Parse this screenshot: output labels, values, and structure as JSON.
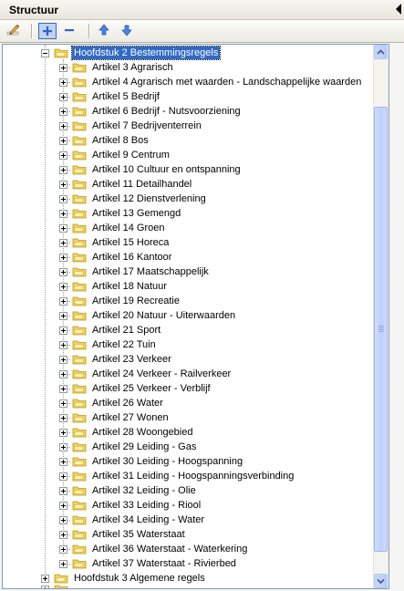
{
  "panel": {
    "title": "Structuur"
  },
  "toolbar": {
    "edit_icon": "pencil-icon",
    "expand_icon": "plus-icon",
    "collapse_icon": "minus-icon",
    "move_up_icon": "arrow-up-icon",
    "move_down_icon": "arrow-down-icon"
  },
  "tree": {
    "parent": {
      "label": "Hoofdstuk 2 Bestemmingsregels",
      "expanded": true,
      "selected": true
    },
    "children": [
      "Artikel 3 Agrarisch",
      "Artikel 4 Agrarisch met waarden - Landschappelijke waarden",
      "Artikel 5 Bedrijf",
      "Artikel 6 Bedrijf - Nutsvoorziening",
      "Artikel 7 Bedrijventerrein",
      "Artikel 8 Bos",
      "Artikel 9 Centrum",
      "Artikel 10 Cultuur en ontspanning",
      "Artikel 11 Detailhandel",
      "Artikel 12 Dienstverlening",
      "Artikel 13 Gemengd",
      "Artikel 14 Groen",
      "Artikel 15 Horeca",
      "Artikel 16 Kantoor",
      "Artikel 17 Maatschappelijk",
      "Artikel 18 Natuur",
      "Artikel 19 Recreatie",
      "Artikel 20 Natuur - Uiterwaarden",
      "Artikel 21 Sport",
      "Artikel 22 Tuin",
      "Artikel 23 Verkeer",
      "Artikel 24 Verkeer - Railverkeer",
      "Artikel 25 Verkeer - Verblijf",
      "Artikel 26 Water",
      "Artikel 27 Wonen",
      "Artikel 28 Woongebied",
      "Artikel 29 Leiding - Gas",
      "Artikel 30 Leiding - Hoogspanning",
      "Artikel 31 Leiding - Hoogspanningsverbinding",
      "Artikel 32 Leiding - Olie",
      "Artikel 33 Leiding - Riool",
      "Artikel 34 Leiding - Water",
      "Artikel 35 Waterstaat",
      "Artikel 36 Waterstaat - Waterkering",
      "Artikel 37 Waterstaat - Rivierbed"
    ],
    "siblings_after": [
      "Hoofdstuk 3 Algemene regels"
    ]
  },
  "colors": {
    "selection": "#316ac5",
    "folder": "#f4d35c"
  }
}
